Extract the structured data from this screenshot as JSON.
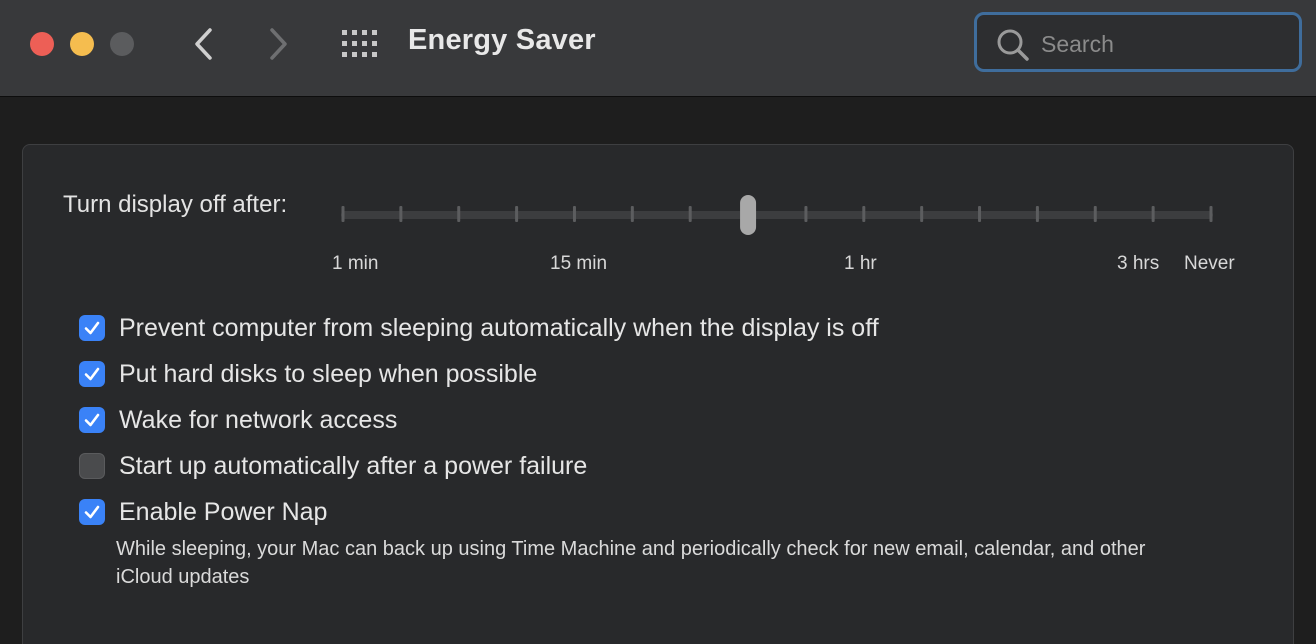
{
  "window": {
    "title": "Energy Saver"
  },
  "toolbar": {
    "back_icon": "chevron-left-icon",
    "forward_icon": "chevron-right-icon",
    "grid_icon": "grid-icon",
    "search_placeholder": "Search",
    "search_value": ""
  },
  "slider": {
    "label": "Turn display off after:",
    "tick_count": 16,
    "selected_tick_index": 7,
    "tick_labels": [
      "1 min",
      "15 min",
      "1 hr",
      "3 hrs",
      "Never"
    ]
  },
  "options": [
    {
      "label": "Prevent computer from sleeping automatically when the display is off",
      "checked": true
    },
    {
      "label": "Put hard disks to sleep when possible",
      "checked": true
    },
    {
      "label": "Wake for network access",
      "checked": true
    },
    {
      "label": "Start up automatically after a power failure",
      "checked": false
    },
    {
      "label": "Enable Power Nap",
      "checked": true
    }
  ],
  "power_nap_description": "While sleeping, your Mac can back up using Time Machine and periodically check for new email, calendar, and other iCloud updates",
  "colors": {
    "accent": "#3a82f7",
    "close": "#ed5f56",
    "minimize": "#f5bd4f",
    "zoom_disabled": "#5b5c5e",
    "search_focus": "#3f6d9c"
  }
}
